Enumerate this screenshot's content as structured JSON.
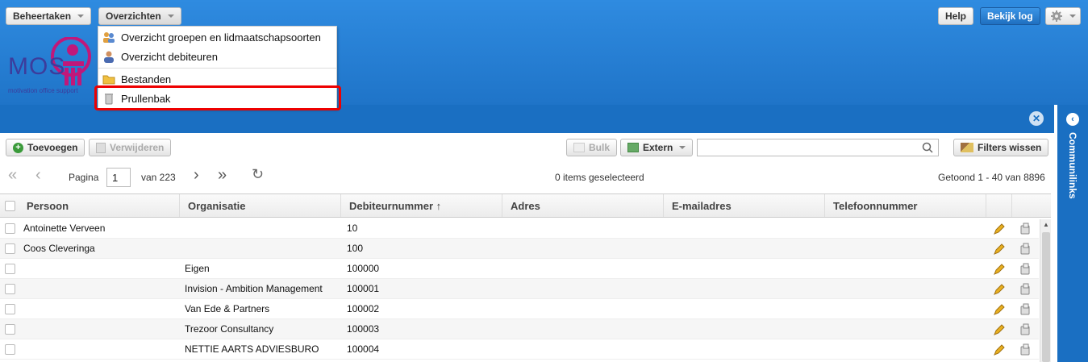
{
  "nav": {
    "menu1": "Beheertaken",
    "menu2": "Overzichten",
    "help": "Help",
    "log": "Bekijk log",
    "settings_icon": "gear-icon"
  },
  "logo": {
    "text": "MOS",
    "tagline": "motivation office support"
  },
  "dropdown": [
    {
      "label": "Overzicht groepen en lidmaatschapsoorten",
      "icon": "groups-icon"
    },
    {
      "label": "Overzicht debiteuren",
      "icon": "person-icon"
    },
    {
      "label": "Bestanden",
      "icon": "folder-icon"
    },
    {
      "label": "Prullenbak",
      "icon": "trash-icon"
    }
  ],
  "side_panel": {
    "label": "Communilinks"
  },
  "toolbar": {
    "add": "Toevoegen",
    "delete": "Verwijderen",
    "bulk": "Bulk",
    "extern": "Extern",
    "search_value": "",
    "clear_filters": "Filters wissen"
  },
  "pager": {
    "page_label": "Pagina",
    "page": "1",
    "of_label": "van 223",
    "selected": "0 items geselecteerd",
    "shown": "Getoond 1 - 40 van 8896"
  },
  "columns": [
    "Persoon",
    "Organisatie",
    "Debiteurnummer ↑",
    "Adres",
    "E-mailadres",
    "Telefoonnummer"
  ],
  "rows": [
    {
      "persoon": "Antoinette Verveen",
      "organisatie": "",
      "debiteur": "10"
    },
    {
      "persoon": "Coos Cleveringa",
      "organisatie": "",
      "debiteur": "100"
    },
    {
      "persoon": "",
      "organisatie": "Eigen",
      "debiteur": "100000"
    },
    {
      "persoon": "",
      "organisatie": "Invision - Ambition Management",
      "debiteur": "100001"
    },
    {
      "persoon": "",
      "organisatie": "Van Ede & Partners",
      "debiteur": "100002"
    },
    {
      "persoon": "",
      "organisatie": "Trezoor Consultancy",
      "debiteur": "100003"
    },
    {
      "persoon": "",
      "organisatie": "NETTIE AARTS ADVIESBURO",
      "debiteur": "100004"
    }
  ],
  "colors": {
    "header_blue": "#2f8be0",
    "highlight_red": "#ee0000"
  }
}
